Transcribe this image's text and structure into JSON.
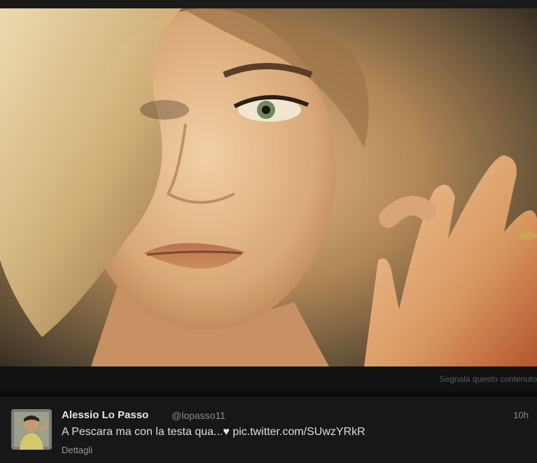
{
  "media": {
    "report_label": "Segnala questo contenuto"
  },
  "tweet": {
    "author_name": "Alessio Lo Passo",
    "author_handle": "@lopasso11",
    "time": "10h",
    "text_prefix": "A Pescara ma con la testa qua...",
    "heart": "♥",
    "link_text": "pic.twitter.com/SUwzYRkR",
    "details_label": "Dettagli"
  },
  "colors": {
    "background": "#0b0b0b",
    "tweet_bg": "#171717",
    "text": "#dddddd",
    "muted": "#8a8a8a"
  }
}
